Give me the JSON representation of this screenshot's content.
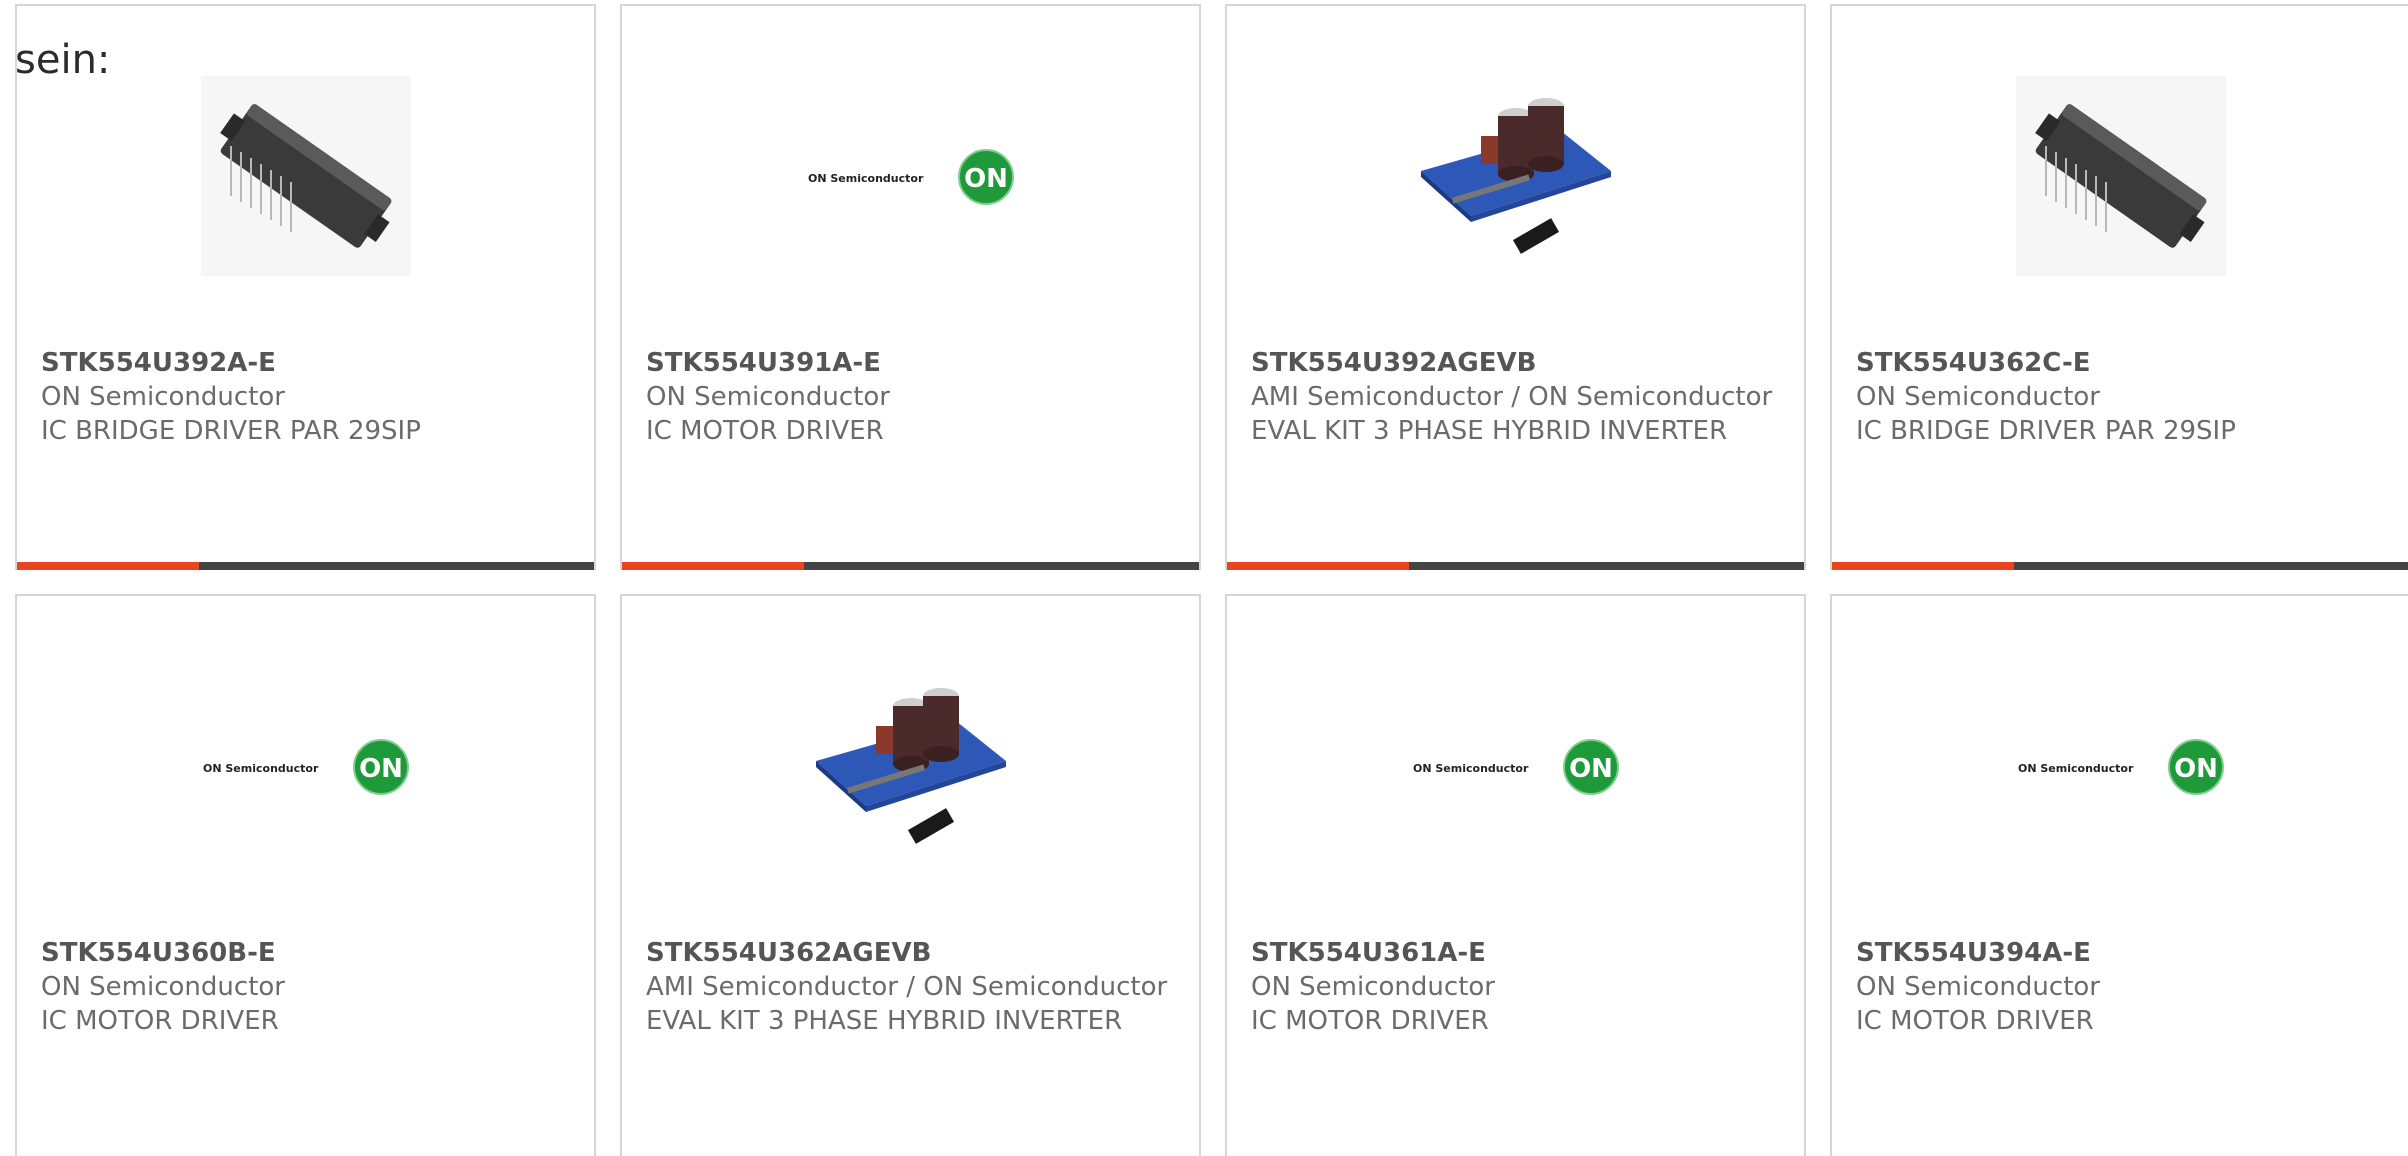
{
  "intro_text": "sein:",
  "colors": {
    "accent": "#e8451e",
    "bar_dark": "#444444",
    "on_green": "#1f9a3a"
  },
  "products": [
    {
      "part_number": "STK554U392A-E",
      "manufacturer": "ON Semiconductor",
      "description": "IC BRIDGE DRIVER PAR 29SIP",
      "image": "ic-module-icon"
    },
    {
      "part_number": "STK554U391A-E",
      "manufacturer": "ON Semiconductor",
      "description": "IC MOTOR DRIVER",
      "image": "on-semiconductor-logo"
    },
    {
      "part_number": "STK554U392AGEVB",
      "manufacturer": "AMI Semiconductor / ON Semiconductor",
      "description": "EVAL KIT 3 PHASE HYBRID INVERTER",
      "image": "eval-board-icon"
    },
    {
      "part_number": "STK554U362C-E",
      "manufacturer": "ON Semiconductor",
      "description": "IC BRIDGE DRIVER PAR 29SIP",
      "image": "ic-module-icon"
    },
    {
      "part_number": "STK554U360B-E",
      "manufacturer": "ON Semiconductor",
      "description": "IC MOTOR DRIVER",
      "image": "on-semiconductor-logo"
    },
    {
      "part_number": "STK554U362AGEVB",
      "manufacturer": "AMI Semiconductor / ON Semiconductor",
      "description": "EVAL KIT 3 PHASE HYBRID INVERTER",
      "image": "eval-board-icon"
    },
    {
      "part_number": "STK554U361A-E",
      "manufacturer": "ON Semiconductor",
      "description": "IC MOTOR DRIVER",
      "image": "on-semiconductor-logo"
    },
    {
      "part_number": "STK554U394A-E",
      "manufacturer": "ON Semiconductor",
      "description": "IC MOTOR DRIVER",
      "image": "on-semiconductor-logo"
    }
  ],
  "logo": {
    "wordmark": "ON Semiconductor",
    "badge": "ON"
  }
}
